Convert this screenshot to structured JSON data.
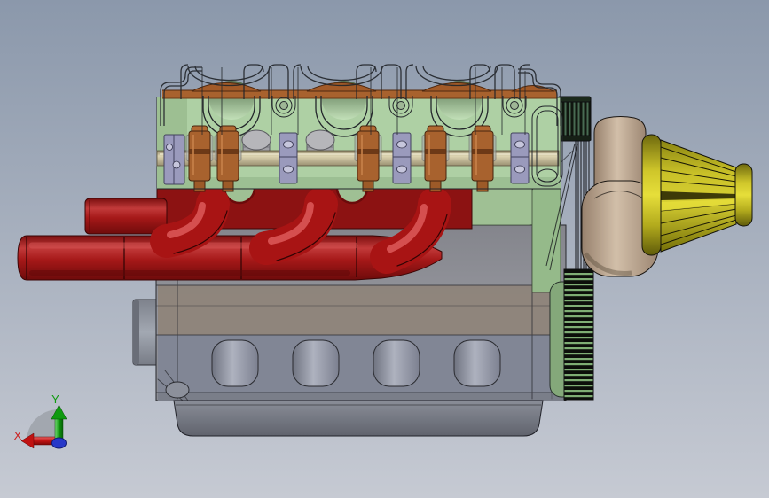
{
  "viewport": {
    "type": "cad-3d-viewport",
    "description": "Shaded-with-edges side view of an inline four-cylinder engine assembly",
    "background_top": "#8b98ab",
    "background_bottom": "#c6cad3"
  },
  "triad": {
    "x_label": "X",
    "y_label": "Y",
    "x_color": "#cc2222",
    "y_color": "#0f9a0f",
    "origin_color": "#2738c8"
  },
  "model": {
    "name": "inline-4-cylinder-engine",
    "parts": [
      {
        "id": "valve-cover",
        "appearance": "transparent-wireframe"
      },
      {
        "id": "cylinder-head",
        "color": "#aed0a4"
      },
      {
        "id": "camshaft",
        "color": "#ddd5b2"
      },
      {
        "id": "rocker-towers",
        "color": "#a8622e",
        "count": 5
      },
      {
        "id": "valve-guides",
        "color": "#9a9abc",
        "count": 3
      },
      {
        "id": "spring-caps",
        "color": "#b6b6ba",
        "count": 2
      },
      {
        "id": "exhaust-header",
        "color": "#a81414",
        "runners": 3
      },
      {
        "id": "engine-block",
        "color": "#94959c"
      },
      {
        "id": "bearing-bulges",
        "count": 4
      },
      {
        "id": "oil-pan",
        "color": "#767a84"
      },
      {
        "id": "cam-pulley",
        "color": "#486b52"
      },
      {
        "id": "timing-belt",
        "color": "#15161a"
      },
      {
        "id": "crank-gear",
        "color": "#7fae74"
      },
      {
        "id": "blower-housing",
        "color": "#d2bfa9"
      },
      {
        "id": "air-filter",
        "color": "#d6ce32"
      }
    ]
  }
}
